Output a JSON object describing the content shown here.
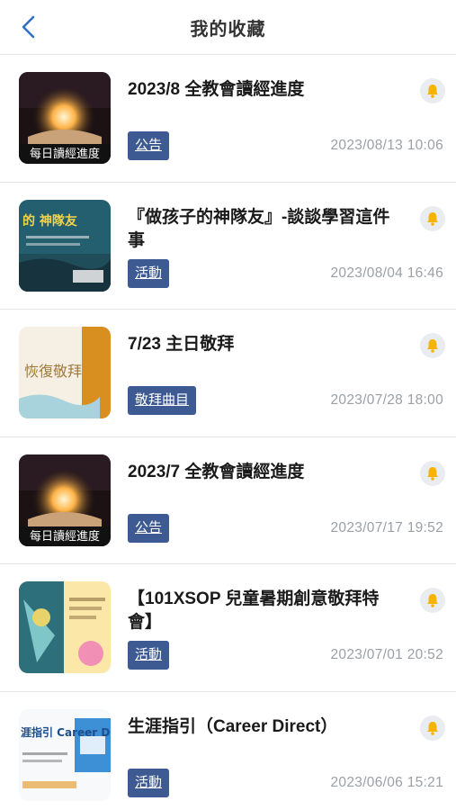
{
  "header": {
    "title": "我的收藏",
    "back_icon": "chevron-left-icon"
  },
  "colors": {
    "accent": "#3e5a93",
    "back": "#2f6fc6",
    "bell": "#f5b400"
  },
  "items": [
    {
      "title": "2023/8 全教會讀經進度",
      "tag": "公告",
      "date": "2023/08/13 10:06",
      "thumb": "bible-reading",
      "thumb_text": "每日讀經進度"
    },
    {
      "title": "『做孩子的神隊友』-談談學習這件事",
      "tag": "活動",
      "date": "2023/08/04 16:46",
      "thumb": "teal-poster",
      "thumb_text": "的 神隊友"
    },
    {
      "title": "7/23 主日敬拜",
      "tag": "敬拜曲目",
      "date": "2023/07/28 18:00",
      "thumb": "worship",
      "thumb_text": "恢復敬拜"
    },
    {
      "title": "2023/7 全教會讀經進度",
      "tag": "公告",
      "date": "2023/07/17 19:52",
      "thumb": "bible-reading",
      "thumb_text": "每日讀經進度"
    },
    {
      "title": "【101XSOP 兒童暑期創意敬拜特會】",
      "tag": "活動",
      "date": "2023/07/01 20:52",
      "thumb": "kids",
      "thumb_text": ""
    },
    {
      "title": "生涯指引（Career Direct）",
      "tag": "活動",
      "date": "2023/06/06 15:21",
      "thumb": "career",
      "thumb_text": "涯指引 Career Direct"
    }
  ]
}
